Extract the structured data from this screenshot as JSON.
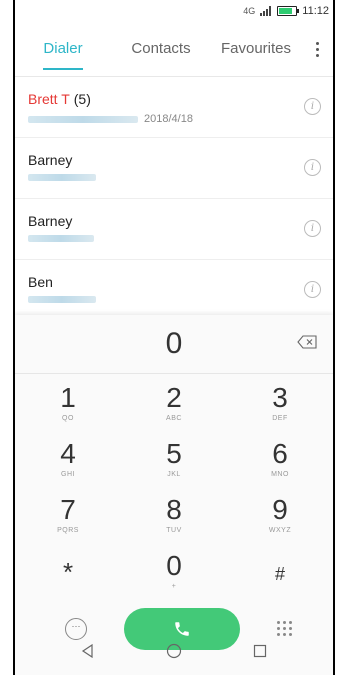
{
  "status_bar": {
    "time": "11:12",
    "signal_text": "4G",
    "battery_level": 0.75
  },
  "tabs": [
    {
      "label": "Dialer",
      "active": true
    },
    {
      "label": "Contacts",
      "active": false
    },
    {
      "label": "Favourites",
      "active": false
    }
  ],
  "call_log": [
    {
      "name": "Brett T",
      "count": "(5)",
      "date": "2018/4/18",
      "missed": true
    },
    {
      "name": "Barney",
      "count": "",
      "date": "",
      "missed": false
    },
    {
      "name": "Barney",
      "count": "",
      "date": "",
      "missed": false
    },
    {
      "name": "Ben",
      "count": "",
      "date": "",
      "missed": false
    }
  ],
  "dialer": {
    "display": "0",
    "keys": [
      {
        "digit": "1",
        "letters": "QO"
      },
      {
        "digit": "2",
        "letters": "ABC"
      },
      {
        "digit": "3",
        "letters": "DEF"
      },
      {
        "digit": "4",
        "letters": "GHI"
      },
      {
        "digit": "5",
        "letters": "JKL"
      },
      {
        "digit": "6",
        "letters": "MNO"
      },
      {
        "digit": "7",
        "letters": "PQRS"
      },
      {
        "digit": "8",
        "letters": "TUV"
      },
      {
        "digit": "9",
        "letters": "WXYZ"
      },
      {
        "digit": "*",
        "letters": ""
      },
      {
        "digit": "0",
        "letters": "+"
      },
      {
        "digit": "#",
        "letters": ""
      }
    ]
  },
  "colors": {
    "accent": "#2eb6c8",
    "missed": "#e53935",
    "call": "#43c978"
  },
  "icons": {
    "info": "info-icon",
    "backspace": "backspace-icon",
    "message": "message-icon",
    "call": "phone-icon",
    "dialpad": "dialpad-icon"
  }
}
